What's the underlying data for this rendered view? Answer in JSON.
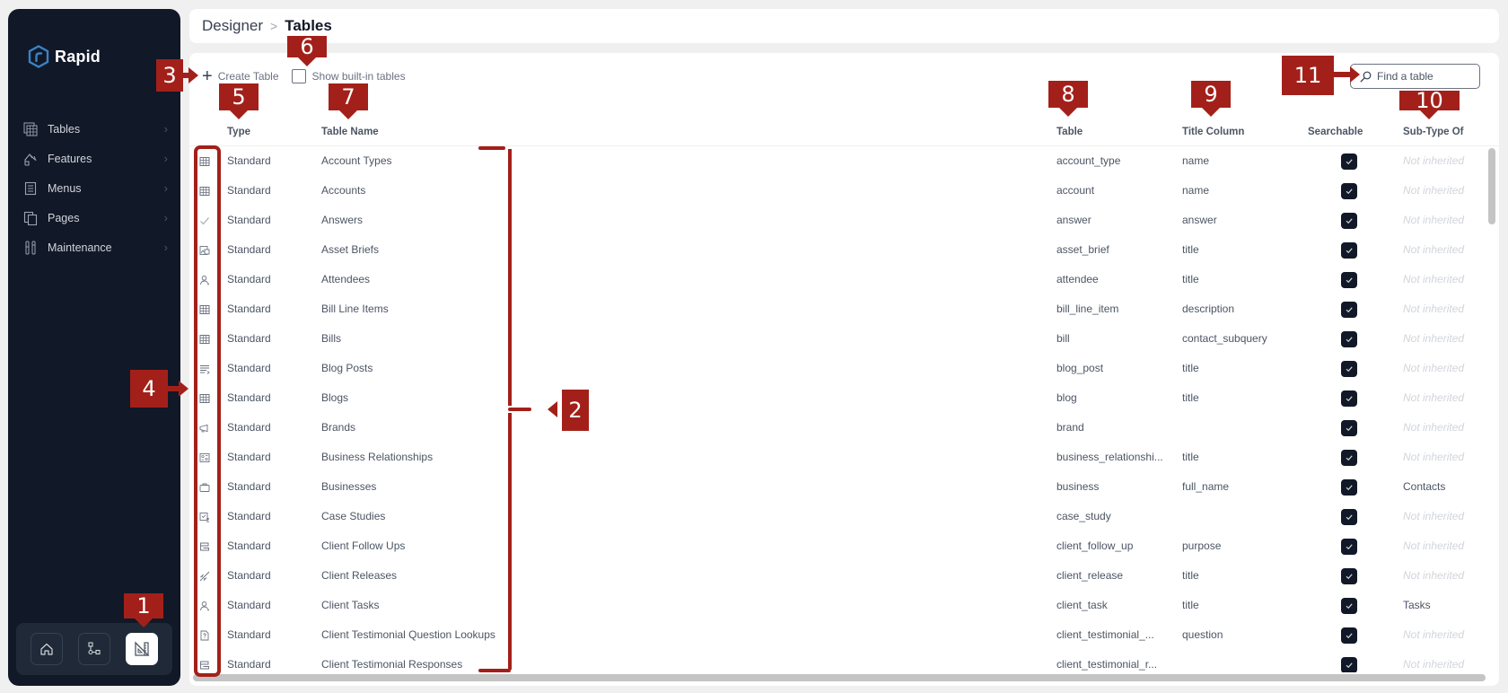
{
  "app": {
    "logo_text": "Rapid",
    "accent_color": "#3b82c4",
    "sidebar_bg": "#111827"
  },
  "sidebar": {
    "items": [
      {
        "label": "Tables",
        "icon": "table-icon"
      },
      {
        "label": "Features",
        "icon": "crane-icon"
      },
      {
        "label": "Menus",
        "icon": "menu-icon"
      },
      {
        "label": "Pages",
        "icon": "pages-icon"
      },
      {
        "label": "Maintenance",
        "icon": "tools-icon"
      }
    ],
    "dock": [
      {
        "name": "home",
        "icon": "home-icon",
        "active": false
      },
      {
        "name": "workflow",
        "icon": "workflow-icon",
        "active": false
      },
      {
        "name": "designer",
        "icon": "designer-icon",
        "active": true
      }
    ]
  },
  "header": {
    "breadcrumb_root": "Designer",
    "separator": ">",
    "breadcrumb_current": "Tables"
  },
  "toolbar": {
    "create_label": "Create Table",
    "show_builtin_label": "Show built-in tables",
    "show_builtin_checked": false,
    "search_placeholder": "Find a table"
  },
  "table": {
    "columns": {
      "type": "Type",
      "table_name": "Table Name",
      "table": "Table",
      "title_column": "Title Column",
      "searchable": "Searchable",
      "subtype_of": "Sub-Type Of"
    },
    "rows": [
      {
        "icon": "table-grid-icon",
        "type": "Standard",
        "name": "Account Types",
        "table": "account_type",
        "title": "name",
        "searchable": true,
        "subtype": "Not inherited",
        "inherited": false
      },
      {
        "icon": "table-grid-icon",
        "type": "Standard",
        "name": "Accounts",
        "table": "account",
        "title": "name",
        "searchable": true,
        "subtype": "Not inherited",
        "inherited": false
      },
      {
        "icon": "check-icon",
        "type": "Standard",
        "name": "Answers",
        "table": "answer",
        "title": "answer",
        "searchable": true,
        "subtype": "Not inherited",
        "inherited": false
      },
      {
        "icon": "image-doc-icon",
        "type": "Standard",
        "name": "Asset Briefs",
        "table": "asset_brief",
        "title": "title",
        "searchable": true,
        "subtype": "Not inherited",
        "inherited": false
      },
      {
        "icon": "person-icon",
        "type": "Standard",
        "name": "Attendees",
        "table": "attendee",
        "title": "title",
        "searchable": true,
        "subtype": "Not inherited",
        "inherited": false
      },
      {
        "icon": "table-grid-icon",
        "type": "Standard",
        "name": "Bill Line Items",
        "table": "bill_line_item",
        "title": "description",
        "searchable": true,
        "subtype": "Not inherited",
        "inherited": false
      },
      {
        "icon": "table-grid-icon",
        "type": "Standard",
        "name": "Bills",
        "table": "bill",
        "title": "contact_subquery",
        "searchable": true,
        "subtype": "Not inherited",
        "inherited": false
      },
      {
        "icon": "list-icon",
        "type": "Standard",
        "name": "Blog Posts",
        "table": "blog_post",
        "title": "title",
        "searchable": true,
        "subtype": "Not inherited",
        "inherited": false
      },
      {
        "icon": "table-grid-icon",
        "type": "Standard",
        "name": "Blogs",
        "table": "blog",
        "title": "title",
        "searchable": true,
        "subtype": "Not inherited",
        "inherited": false
      },
      {
        "icon": "megaphone-icon",
        "type": "Standard",
        "name": "Brands",
        "table": "brand",
        "title": "",
        "searchable": true,
        "subtype": "Not inherited",
        "inherited": false
      },
      {
        "icon": "relationship-icon",
        "type": "Standard",
        "name": "Business Relationships",
        "table": "business_relationshi...",
        "title": "title",
        "searchable": true,
        "subtype": "Not inherited",
        "inherited": false
      },
      {
        "icon": "briefcase-icon",
        "type": "Standard",
        "name": "Businesses",
        "table": "business",
        "title": "full_name",
        "searchable": true,
        "subtype": "Contacts",
        "inherited": true
      },
      {
        "icon": "case-study-icon",
        "type": "Standard",
        "name": "Case Studies",
        "table": "case_study",
        "title": "",
        "searchable": true,
        "subtype": "Not inherited",
        "inherited": false
      },
      {
        "icon": "follow-up-icon",
        "type": "Standard",
        "name": "Client Follow Ups",
        "table": "client_follow_up",
        "title": "purpose",
        "searchable": true,
        "subtype": "Not inherited",
        "inherited": false
      },
      {
        "icon": "rocket-icon",
        "type": "Standard",
        "name": "Client Releases",
        "table": "client_release",
        "title": "title",
        "searchable": true,
        "subtype": "Not inherited",
        "inherited": false
      },
      {
        "icon": "person-icon",
        "type": "Standard",
        "name": "Client Tasks",
        "table": "client_task",
        "title": "title",
        "searchable": true,
        "subtype": "Tasks",
        "inherited": true
      },
      {
        "icon": "question-doc-icon",
        "type": "Standard",
        "name": "Client Testimonial Question Lookups",
        "table": "client_testimonial_...",
        "title": "question",
        "searchable": true,
        "subtype": "Not inherited",
        "inherited": false
      },
      {
        "icon": "follow-up-icon",
        "type": "Standard",
        "name": "Client Testimonial Responses",
        "table": "client_testimonial_r...",
        "title": "",
        "searchable": true,
        "subtype": "Not inherited",
        "inherited": false
      }
    ]
  },
  "annotations": {
    "color": "#a3201a",
    "labels": [
      "1",
      "2",
      "3",
      "4",
      "5",
      "6",
      "7",
      "8",
      "9",
      "10",
      "11"
    ]
  }
}
